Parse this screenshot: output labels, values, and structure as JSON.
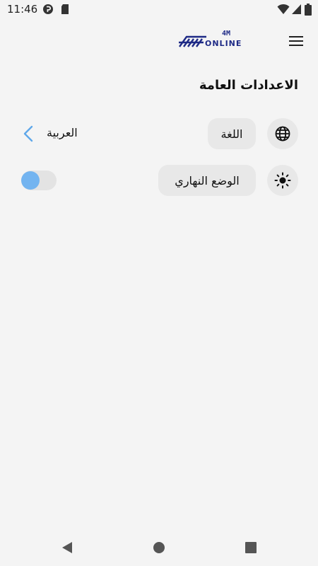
{
  "status_bar": {
    "time": "11:46",
    "icons": [
      "p-app-notification-icon",
      "sd-card-icon",
      "wifi-icon",
      "signal-icon",
      "battery-icon"
    ]
  },
  "app_bar": {
    "logo_top": "4M",
    "logo_bottom": "ONLINE",
    "menu_icon": "hamburger-menu-icon"
  },
  "page": {
    "title": "الاعدادات العامة"
  },
  "settings": {
    "language": {
      "label": "اللغة",
      "value": "العربية",
      "icon": "globe-icon"
    },
    "day_mode": {
      "label": "الوضع النهاري",
      "icon": "sun-icon",
      "enabled": false
    }
  },
  "colors": {
    "background": "#f4f4f4",
    "pill": "#e8e8e8",
    "accent": "#73b4f0",
    "logo": "#1e2a86"
  },
  "nav_bar": {
    "buttons": [
      "back-icon",
      "home-icon",
      "recents-icon"
    ]
  }
}
